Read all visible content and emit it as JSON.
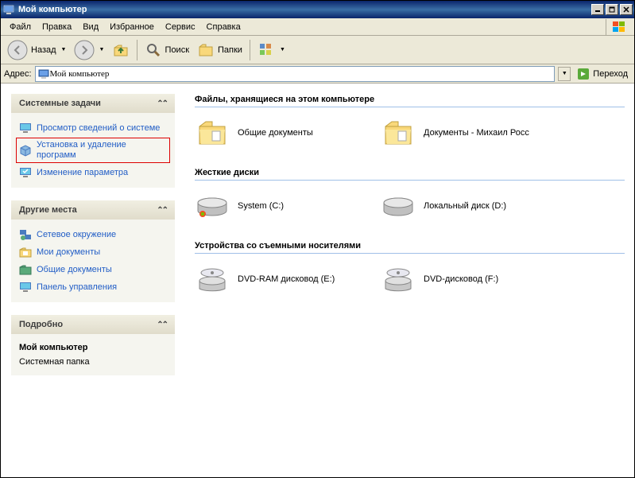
{
  "window": {
    "title": "Мой компьютер"
  },
  "menu": [
    "Файл",
    "Правка",
    "Вид",
    "Избранное",
    "Сервис",
    "Справка"
  ],
  "toolbar": {
    "back": "Назад",
    "search": "Поиск",
    "folders": "Папки"
  },
  "address": {
    "label": "Адрес:",
    "value": "Мой компьютер",
    "go": "Переход"
  },
  "panels": {
    "system": {
      "title": "Системные задачи",
      "items": [
        "Просмотр сведений о системе",
        "Установка и удаление программ",
        "Изменение параметра"
      ]
    },
    "other": {
      "title": "Другие места",
      "items": [
        "Сетевое окружение",
        "Мои документы",
        "Общие документы",
        "Панель управления"
      ]
    },
    "details": {
      "title": "Подробно",
      "name": "Мой компьютер",
      "type": "Системная папка"
    }
  },
  "sections": {
    "files": {
      "title": "Файлы, хранящиеся на этом компьютере",
      "items": [
        "Общие документы",
        "Документы - Михаил Росс"
      ]
    },
    "disks": {
      "title": "Жесткие диски",
      "items": [
        "System (C:)",
        "Локальный диск (D:)"
      ]
    },
    "removable": {
      "title": "Устройства со съемными носителями",
      "items": [
        "DVD-RAM дисковод (E:)",
        "DVD-дисковод (F:)"
      ]
    }
  }
}
